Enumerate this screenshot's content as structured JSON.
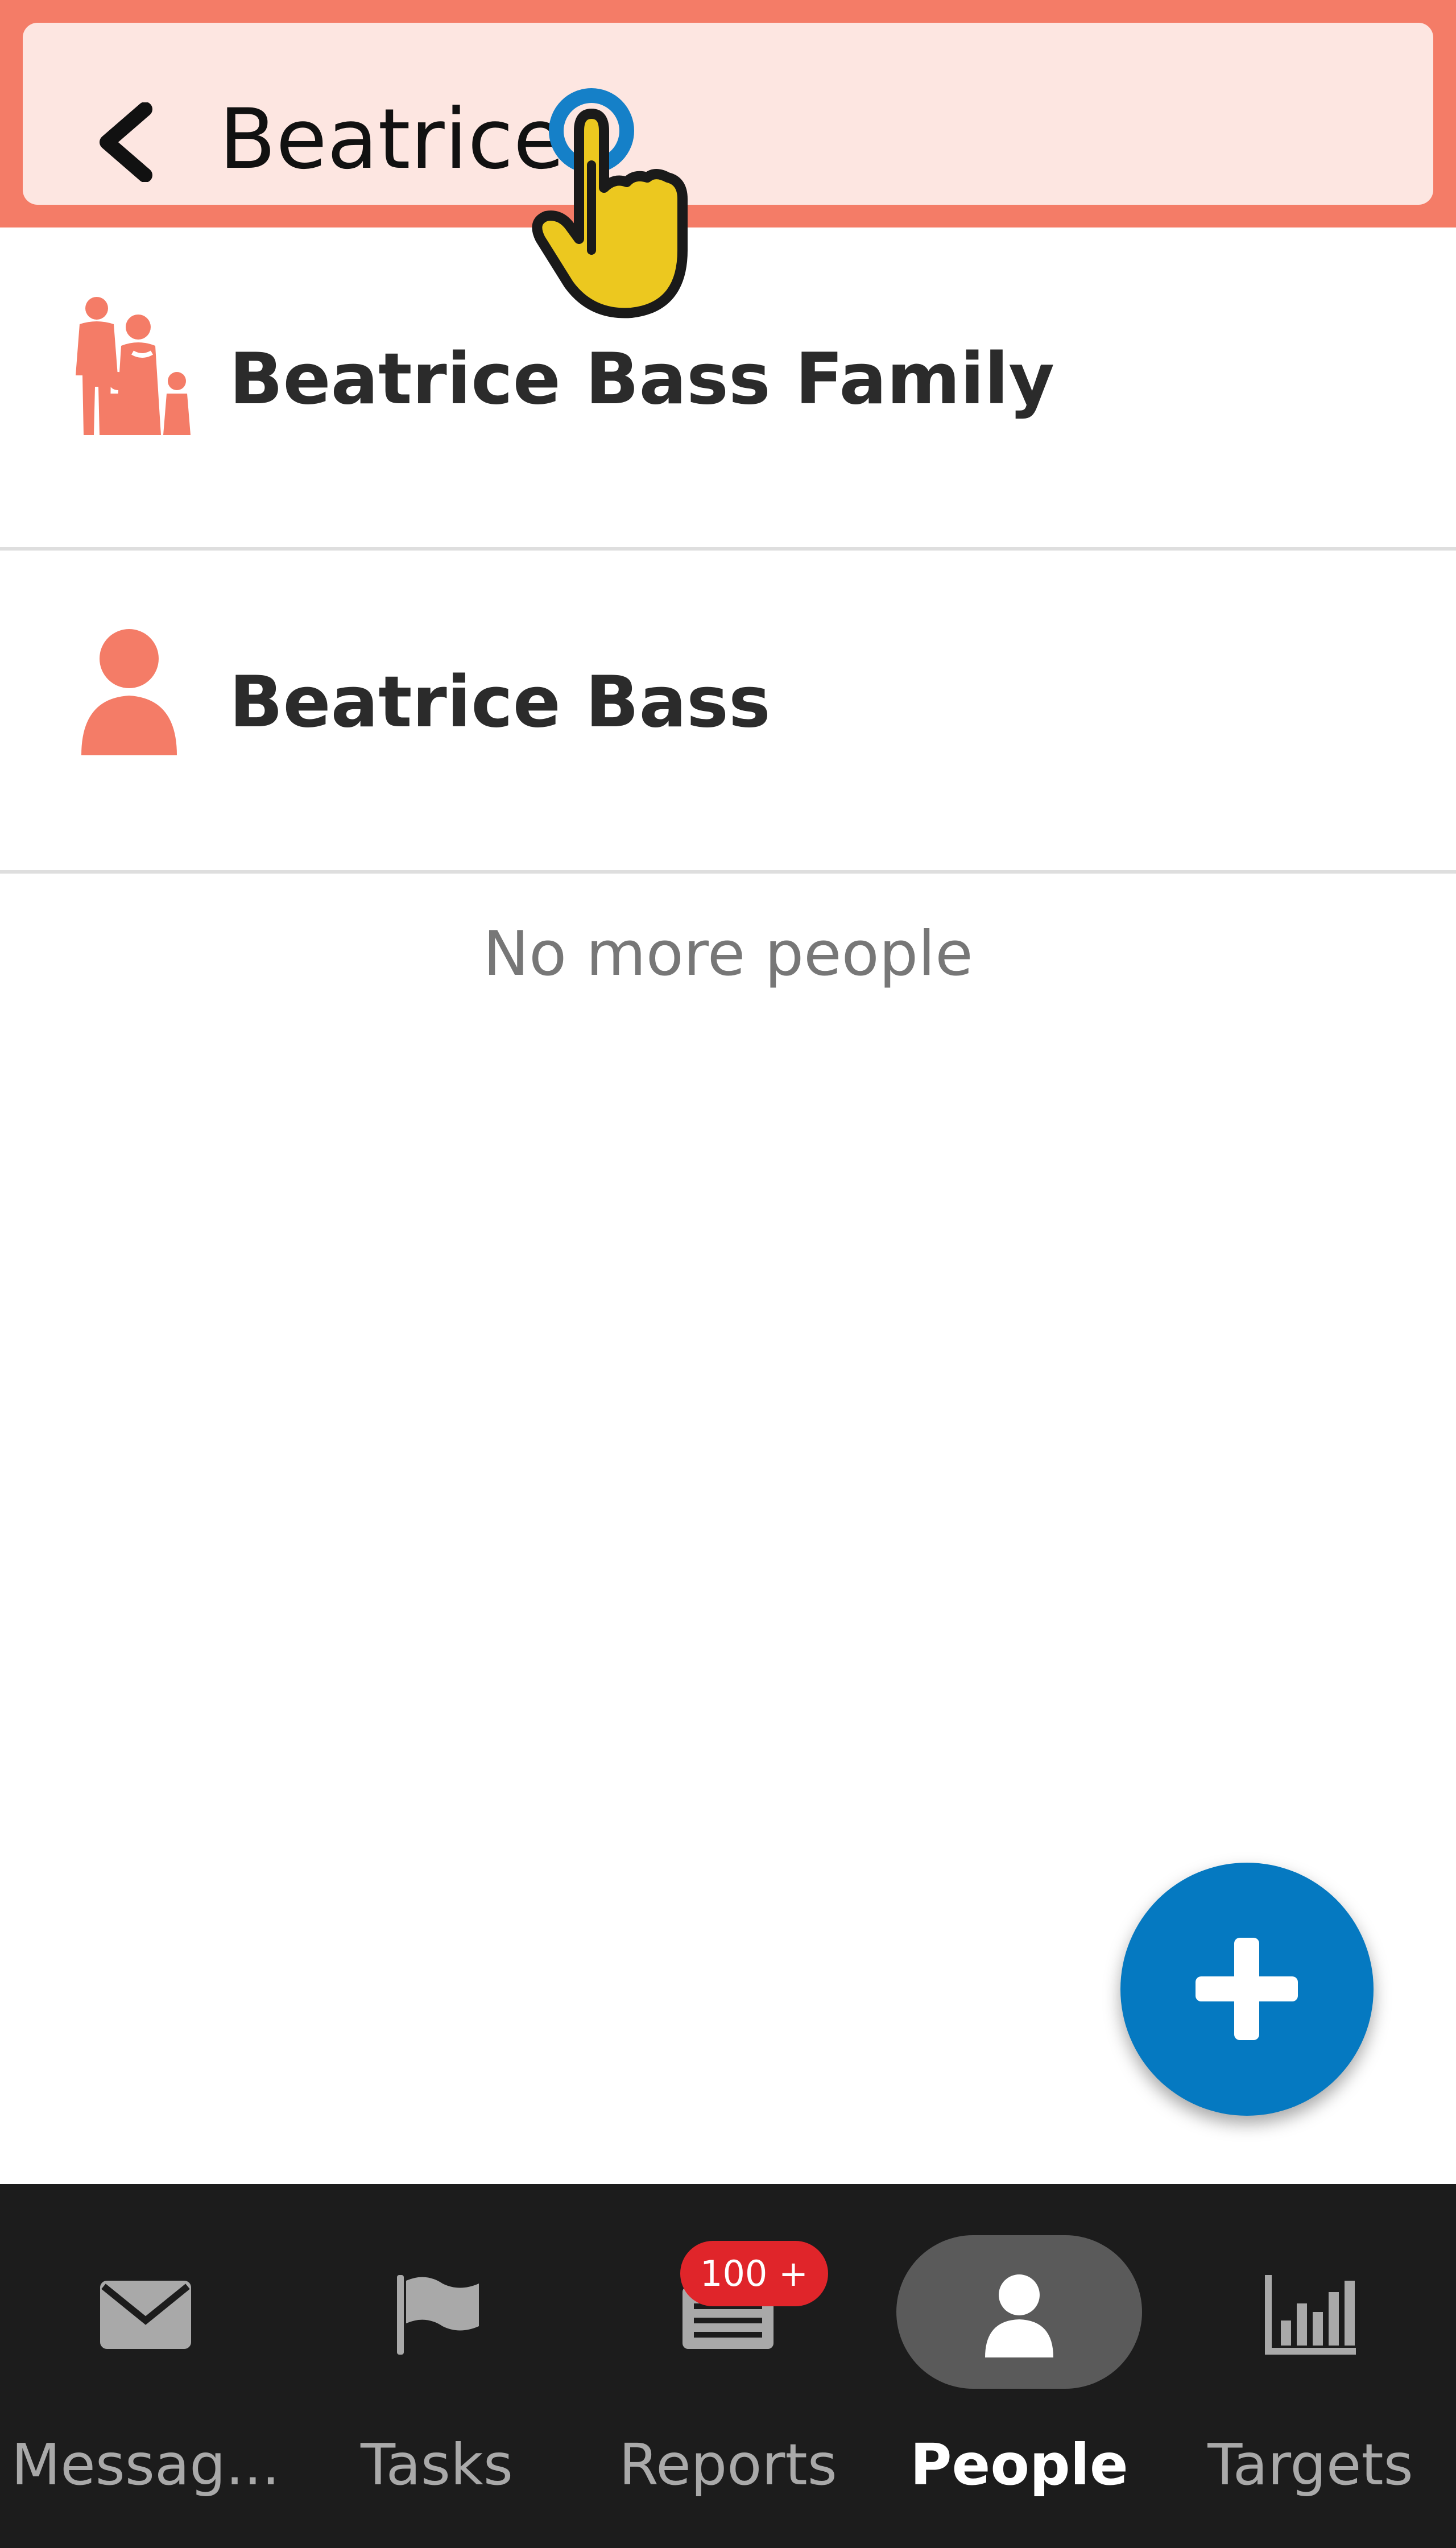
{
  "search": {
    "value": "Beatrice",
    "back_icon": "chevron-left-icon"
  },
  "results": [
    {
      "label": "Beatrice Bass Family",
      "icon": "family-icon"
    },
    {
      "label": "Beatrice Bass",
      "icon": "person-icon"
    }
  ],
  "list_end_text": "No more people",
  "fab": {
    "icon": "plus-icon"
  },
  "bottom_nav": {
    "items": [
      {
        "label": "Messag...",
        "icon": "envelope-icon",
        "active": false
      },
      {
        "label": "Tasks",
        "icon": "flag-icon",
        "active": false
      },
      {
        "label": "Reports",
        "icon": "reports-icon",
        "active": false,
        "badge": "100 +"
      },
      {
        "label": "People",
        "icon": "person-icon",
        "active": true
      },
      {
        "label": "Targets",
        "icon": "bar-chart-icon",
        "active": false
      }
    ]
  },
  "colors": {
    "header": "#f47c67",
    "search_bg": "#fde6e1",
    "contact_icon": "#f47c67",
    "fab": "#0579c1",
    "nav_bg": "#1c1c1c",
    "badge": "#e0252a"
  }
}
